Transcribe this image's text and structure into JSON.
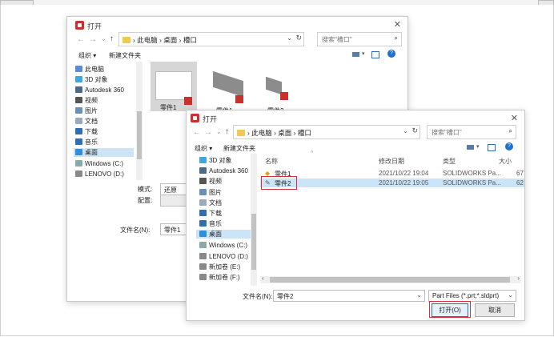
{
  "back_dialog": {
    "title": "打开",
    "breadcrumb": [
      "此电脑",
      "桌面",
      "槽口"
    ],
    "search_placeholder": "搜索\"槽口\"",
    "toolbar": {
      "organize": "组织 ▾",
      "new_folder": "新建文件夹"
    },
    "sidebar": [
      "此电脑",
      "3D 对象",
      "Autodesk 360",
      "视频",
      "图片",
      "文档",
      "下载",
      "音乐",
      "桌面",
      "Windows (C:)",
      "LENOVO (D:)"
    ],
    "files": [
      "零件1",
      "零件1",
      "零件2"
    ],
    "mode_label": "模式:",
    "mode_value": "还原",
    "config_label": "配置:",
    "filename_label": "文件名(N):",
    "filename_value": "零件1"
  },
  "front_dialog": {
    "title": "打开",
    "breadcrumb": [
      "此电脑",
      "桌面",
      "槽口"
    ],
    "search_placeholder": "搜索\"槽口\"",
    "toolbar": {
      "organize": "组织 ▾",
      "new_folder": "新建文件夹"
    },
    "sidebar": [
      "3D 对象",
      "Autodesk 360",
      "视频",
      "图片",
      "文档",
      "下载",
      "音乐",
      "桌面",
      "Windows (C:)",
      "LENOVO (D:)",
      "新加卷 (E:)",
      "新加卷 (F:)"
    ],
    "columns": {
      "name": "名称",
      "date": "修改日期",
      "type": "类型",
      "size": "大小"
    },
    "rows": [
      {
        "name": "零件1",
        "date": "2021/10/22 19:04",
        "type": "SOLIDWORKS Pa...",
        "size": "67"
      },
      {
        "name": "零件2",
        "date": "2021/10/22 19:05",
        "type": "SOLIDWORKS Pa...",
        "size": "62"
      }
    ],
    "filename_label": "文件名(N):",
    "filename_value": "零件2",
    "filetype_value": "Part Files (*.prt;*.sldprt)",
    "open_button": "打开(O)",
    "cancel_button": "取消"
  },
  "colors": {
    "selection": "#cce4f7",
    "highlight_box": "#d8303a",
    "folder": "#f2c94c"
  }
}
